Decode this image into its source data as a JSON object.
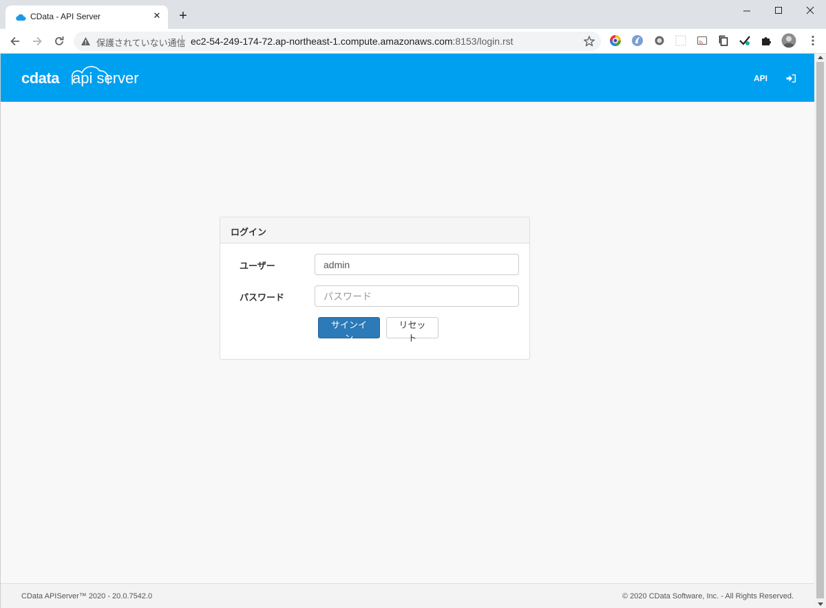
{
  "browser": {
    "tab_title": "CData - API Server",
    "tab_close": "✕",
    "new_tab": "+",
    "security_label": "保護されていない通信",
    "url_host": "ec2-54-249-174-72.ap-northeast-1.compute.amazonaws.com",
    "url_path": ":8153/login.rst",
    "extensions": [
      "color-wheel-icon",
      "edge-icon",
      "circle-icon",
      "grid-icon",
      "cast-icon",
      "copy-icon",
      "check-icon",
      "puzzle-icon",
      "profile-avatar"
    ]
  },
  "header": {
    "brand_cdata": "cdata",
    "brand_product": "api server",
    "api_link": "API",
    "bg_color": "#00a0f0"
  },
  "login": {
    "panel_title": "ログイン",
    "user_label": "ユーザー",
    "user_value": "admin",
    "password_label": "パスワード",
    "password_placeholder": "パスワード",
    "signin_button": "サインイン",
    "reset_button": "リセット",
    "primary_color": "#2c7ab8"
  },
  "footer": {
    "version": "CData APIServer™ 2020 - 20.0.7542.0",
    "copyright": "© 2020 CData Software, Inc. - All Rights Reserved."
  }
}
